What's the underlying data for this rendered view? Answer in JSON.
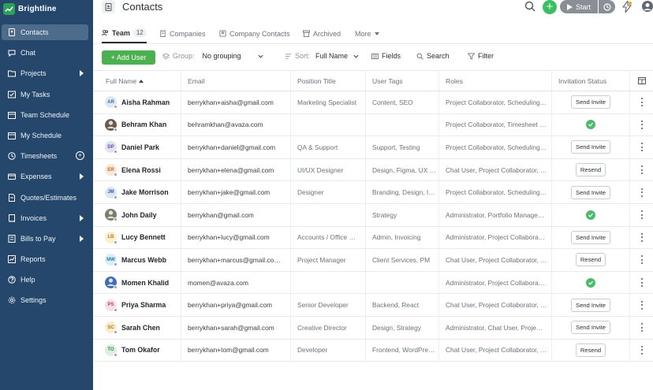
{
  "app": {
    "name": "Brightline"
  },
  "sidebar": {
    "items": [
      {
        "label": "Contacts",
        "icon": "contacts-icon",
        "active": true
      },
      {
        "label": "Chat",
        "icon": "chat-icon"
      },
      {
        "label": "Projects",
        "icon": "folder-icon",
        "expand": true
      },
      {
        "label": "My Tasks",
        "icon": "tasks-icon"
      },
      {
        "label": "Team Schedule",
        "icon": "calendar-icon"
      },
      {
        "label": "My Schedule",
        "icon": "calendar-icon"
      },
      {
        "label": "Timesheets",
        "icon": "clock-icon",
        "plus": true
      },
      {
        "label": "Expenses",
        "icon": "expenses-icon",
        "expand": true
      },
      {
        "label": "Quotes/Estimates",
        "icon": "document-icon"
      },
      {
        "label": "Invoices",
        "icon": "invoice-icon",
        "expand": true
      },
      {
        "label": "Bills to Pay",
        "icon": "bill-icon",
        "expand": true
      },
      {
        "label": "Reports",
        "icon": "reports-icon"
      },
      {
        "label": "Help",
        "icon": "help-icon"
      },
      {
        "label": "Settings",
        "icon": "gear-icon"
      }
    ]
  },
  "header": {
    "title": "Contacts",
    "start_label": "Start"
  },
  "tabs": {
    "team": {
      "label": "Team",
      "count": "12"
    },
    "companies": {
      "label": "Companies"
    },
    "company_contacts": {
      "label": "Company Contacts"
    },
    "archived": {
      "label": "Archived"
    },
    "more": {
      "label": "More"
    }
  },
  "toolbar": {
    "add_user": "+ Add User",
    "group_label": "Group:",
    "group_value": "No grouping",
    "sort_label": "Sort:",
    "sort_value": "Full Name",
    "fields": "Fields",
    "search": "Search",
    "filter": "Filter"
  },
  "table": {
    "columns": {
      "name": "Full Name",
      "email": "Email",
      "position": "Position Title",
      "tags": "User Tags",
      "roles": "Roles",
      "invitation": "Invitation Status"
    },
    "rows": [
      {
        "initials": "AR",
        "avatar_bg": "#dfe9f3",
        "avatar_fg": "#3a6e9e",
        "name": "Aisha Rahman",
        "email": "berrykhan+aisha@gmail.com",
        "position": "Marketing Specialist",
        "tags": "Content, SEO",
        "roles": "Project Collaborator, Scheduling…",
        "status": "Send Invite"
      },
      {
        "initials": "",
        "avatar_bg": "#6b5a4e",
        "avatar_fg": "#ffffff",
        "name": "Behram Khan",
        "email": "behramkhan@avaza.com",
        "position": "",
        "tags": "",
        "roles": "Project Collaborator, Timesheet …",
        "status": "accepted"
      },
      {
        "initials": "DP",
        "avatar_bg": "#e2e0f5",
        "avatar_fg": "#5b55a8",
        "name": "Daniel Park",
        "email": "berrykhan+daniel@gmail.com",
        "position": "QA & Support",
        "tags": "Support, Testing",
        "roles": "Project Collaborator, Scheduling…",
        "status": "Send Invite"
      },
      {
        "initials": "ER",
        "avatar_bg": "#fbe7d6",
        "avatar_fg": "#c0662b",
        "name": "Elena Rossi",
        "email": "berrykhan+elena@gmail.com",
        "position": "UI/UX Designer",
        "tags": "Design, Figma, UX …",
        "roles": "Chat User, Project Collaborator, …",
        "status": "Resend"
      },
      {
        "initials": "JM",
        "avatar_bg": "#dce6f5",
        "avatar_fg": "#3c5c9a",
        "name": "Jake Morrison",
        "email": "berrykhan+jake@gmail.com",
        "position": "Designer",
        "tags": "Branding, Design, I…",
        "roles": "Project Collaborator, Scheduling…",
        "status": "Send Invite"
      },
      {
        "initials": "",
        "avatar_bg": "#7a7f6a",
        "avatar_fg": "#ffffff",
        "name": "John Daily",
        "email": "berrykhan@gmail.com",
        "position": "",
        "tags": "Strategy",
        "roles": "Administrator, Portfolio Manage…",
        "status": "accepted"
      },
      {
        "initials": "LB",
        "avatar_bg": "#fbefcf",
        "avatar_fg": "#b08415",
        "name": "Lucy Bennett",
        "email": "berrykhan+lucy@gmail.com",
        "position": "Accounts / Office …",
        "tags": "Admin, Invoicing",
        "roles": "Administrator, Project Collabora…",
        "status": "Send Invite"
      },
      {
        "initials": "MW",
        "avatar_bg": "#d9eef7",
        "avatar_fg": "#2c7ea3",
        "name": "Marcus Webb",
        "email": "berrykhan+marcus@gmail.co…",
        "position": "Project Manager",
        "tags": "Client Services, PM",
        "roles": "Chat User, Project Collaborator, …",
        "status": "Resend"
      },
      {
        "initials": "",
        "avatar_bg": "#3f6fb0",
        "avatar_fg": "#ffffff",
        "name": "Momen Khalid",
        "email": "momen@avaza.com",
        "position": "",
        "tags": "",
        "roles": "Administrator, Project Collabora…",
        "status": "accepted"
      },
      {
        "initials": "PS",
        "avatar_bg": "#f8dfe6",
        "avatar_fg": "#b5466a",
        "name": "Priya Sharma",
        "email": "berrykhan+priya@gmail.com",
        "position": "Senior Developer",
        "tags": "Backend, React",
        "roles": "Chat User, Project Collaborator, …",
        "status": "Send Invite"
      },
      {
        "initials": "SC",
        "avatar_bg": "#fbeccf",
        "avatar_fg": "#b07615",
        "name": "Sarah Chen",
        "email": "berrykhan+sarah@gmail.com",
        "position": "Creative Director",
        "tags": "Design, Strategy",
        "roles": "Administrator, Chat User, Proje…",
        "status": "Send Invite"
      },
      {
        "initials": "TO",
        "avatar_bg": "#dcefe0",
        "avatar_fg": "#3b8a4d",
        "name": "Tom Okafor",
        "email": "berrykhan+tom@gmail.com",
        "position": "Developer",
        "tags": "Frontend, WordPre…",
        "roles": "Chat User, Project Collaborator, …",
        "status": "Resend"
      }
    ]
  }
}
